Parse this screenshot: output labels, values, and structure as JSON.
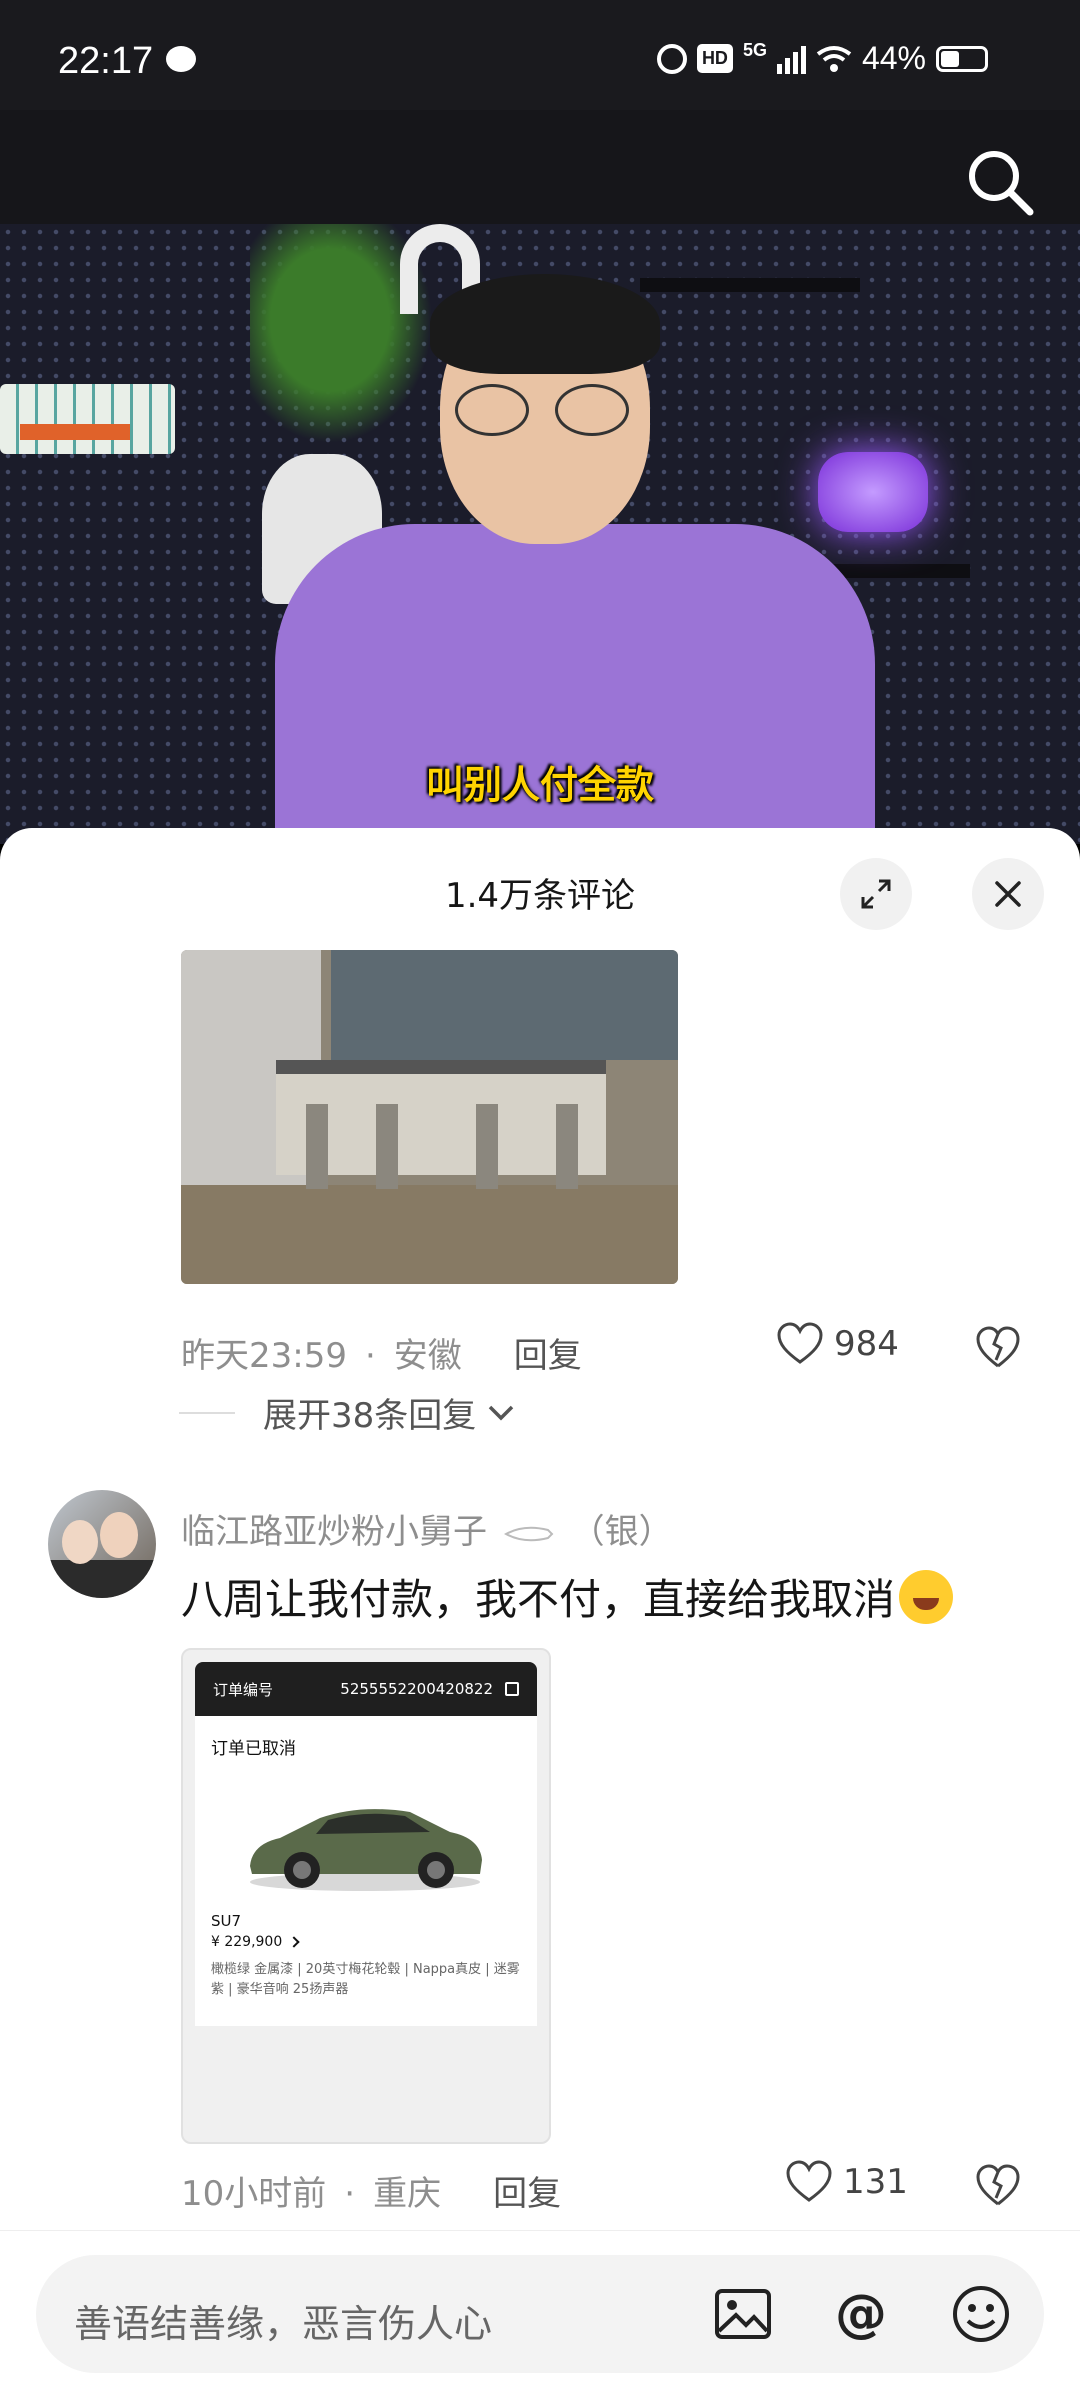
{
  "status_bar": {
    "time": "22:17",
    "battery": "44%",
    "network": "5G",
    "hd_label": "HD"
  },
  "video": {
    "caption": "叫别人付全款"
  },
  "comments_panel": {
    "title": "1.4万条评论",
    "comments": [
      {
        "timestamp": "昨天23:59",
        "location": "安徽",
        "reply_label": "回复",
        "likes": "984",
        "expand_replies": "展开38条回复"
      },
      {
        "username": "临江路亚炒粉小舅子",
        "badge": "（银）",
        "text": "八周让我付款，我不付，直接给我取消",
        "order": {
          "number_label": "订单编号",
          "number": "5255552200420822",
          "status": "订单已取消",
          "model": "SU7",
          "price": "¥ 229,900",
          "spec": "橄榄绿 金属漆 | 20英寸梅花轮毂 | Nappa真皮 | 迷雾紫 | 豪华音响 25扬声器"
        },
        "timestamp": "10小时前",
        "location": "重庆",
        "reply_label": "回复",
        "likes": "131"
      }
    ]
  },
  "input": {
    "placeholder": "善语结善缘，恶言伤人心"
  },
  "separator": "·"
}
